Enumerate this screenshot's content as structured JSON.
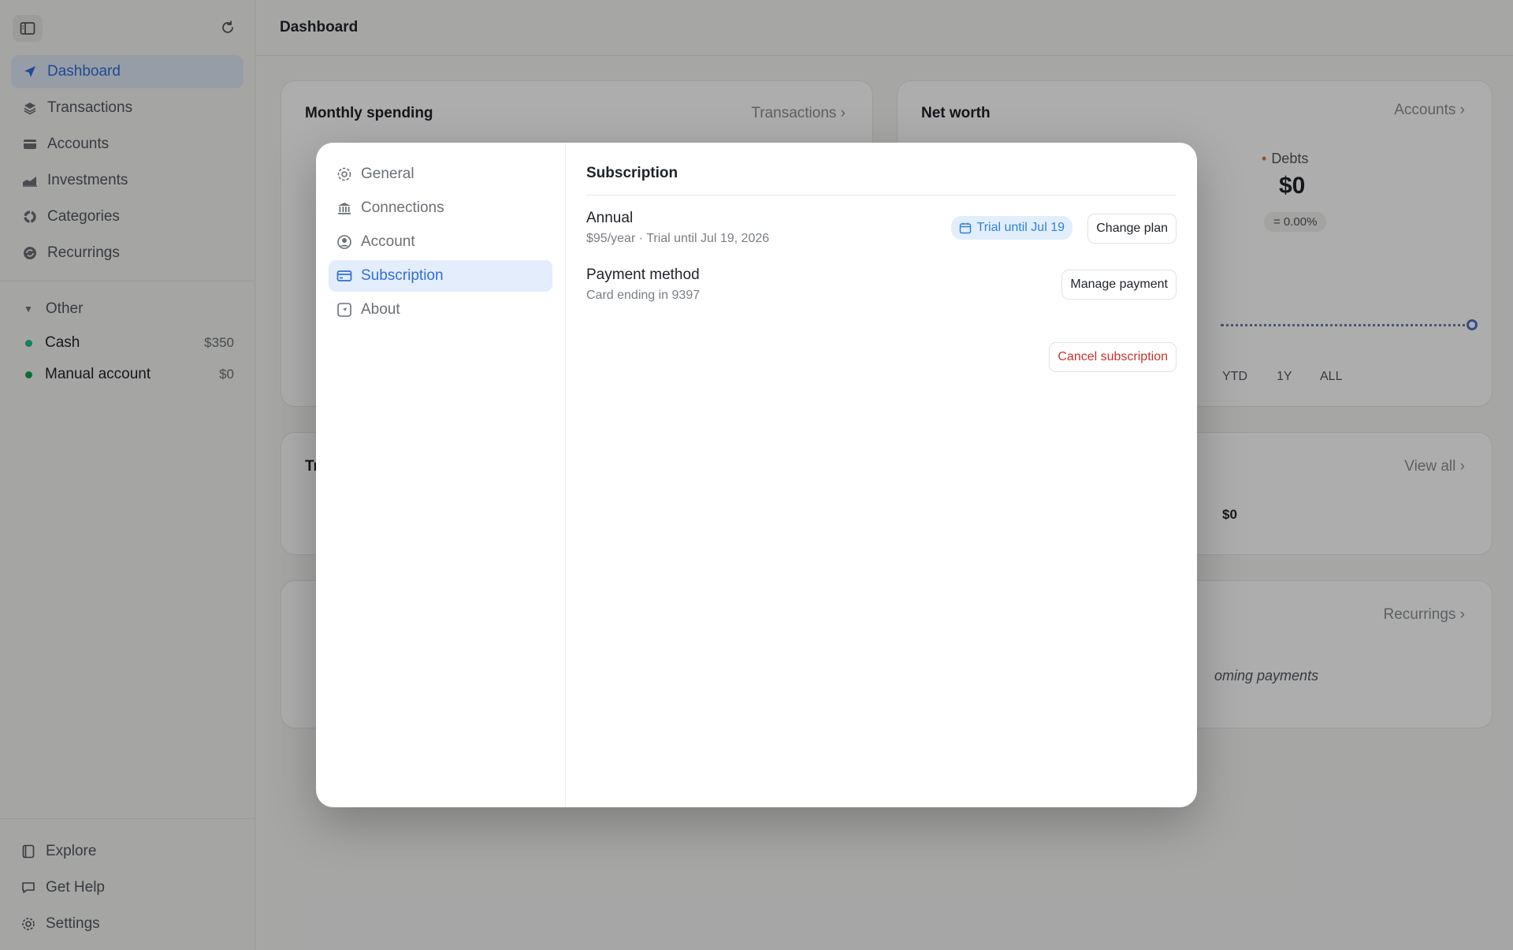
{
  "sidebar": {
    "nav": [
      {
        "label": "Dashboard",
        "icon": "send-icon",
        "active": true
      },
      {
        "label": "Transactions",
        "icon": "layers-icon"
      },
      {
        "label": "Accounts",
        "icon": "credit-card-icon"
      },
      {
        "label": "Investments",
        "icon": "chart-icon"
      },
      {
        "label": "Categories",
        "icon": "donut-icon"
      },
      {
        "label": "Recurrings",
        "icon": "recurring-icon"
      }
    ],
    "group": {
      "label": "Other"
    },
    "accounts": [
      {
        "name": "Cash",
        "amount": "$350",
        "color": "#1bbf8e"
      },
      {
        "name": "Manual account",
        "amount": "$0",
        "color": "#16a34a"
      }
    ],
    "bottom": [
      {
        "label": "Explore",
        "icon": "book-icon"
      },
      {
        "label": "Get Help",
        "icon": "chat-icon"
      },
      {
        "label": "Settings",
        "icon": "gear-icon"
      }
    ]
  },
  "main": {
    "title": "Dashboard",
    "monthly_spending": {
      "title": "Monthly spending",
      "link": "Transactions"
    },
    "net_worth": {
      "title": "Net worth",
      "link": "Accounts",
      "debts_label": "Debts",
      "debts_value": "$0",
      "change": "= 0.00%",
      "ranges": [
        "YTD",
        "1Y",
        "ALL"
      ]
    },
    "transactions_card": {
      "title_fragment": "Tr",
      "link": "View all",
      "value": "$0"
    },
    "recurrings_card": {
      "link": "Recurrings",
      "empty_fragment": "oming payments"
    }
  },
  "modal": {
    "nav": [
      {
        "label": "General",
        "icon": "gear-icon"
      },
      {
        "label": "Connections",
        "icon": "bank-icon"
      },
      {
        "label": "Account",
        "icon": "user-circle-icon"
      },
      {
        "label": "Subscription",
        "icon": "card-icon",
        "active": true
      },
      {
        "label": "About",
        "icon": "info-square-icon"
      }
    ],
    "header": "Subscription",
    "plan": {
      "name": "Annual",
      "detail": "$95/year · Trial until Jul 19, 2026",
      "badge": "Trial until Jul 19",
      "button": "Change plan"
    },
    "payment": {
      "title": "Payment method",
      "detail": "Card ending in 9397",
      "button": "Manage payment"
    },
    "cancel_button": "Cancel subscription"
  },
  "colors": {
    "accent": "#2f6fd8",
    "danger": "#c7352b",
    "badge_bg": "#e3eefc"
  }
}
